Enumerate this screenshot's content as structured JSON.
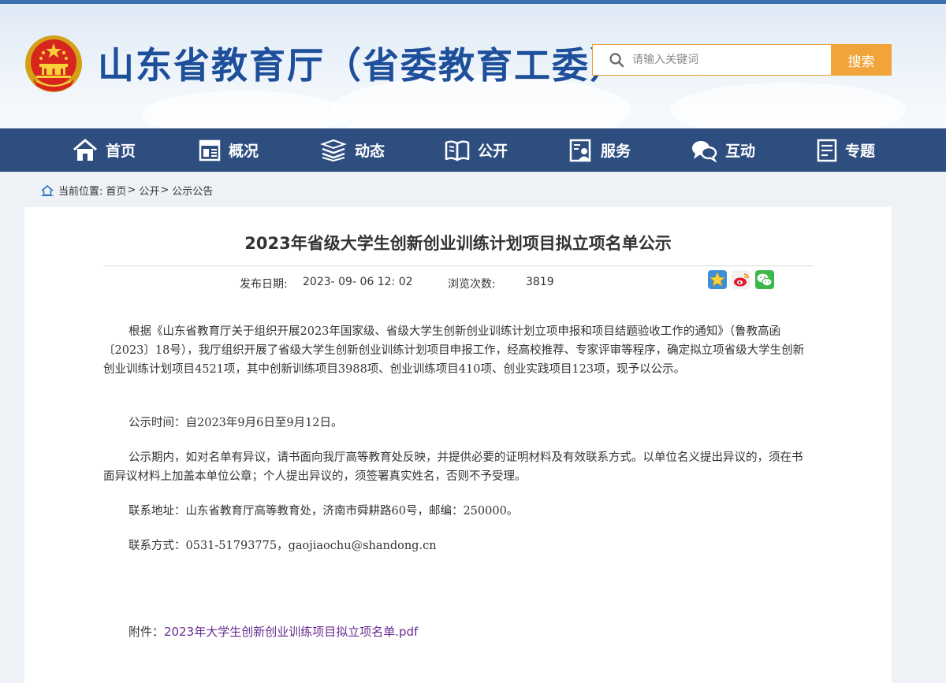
{
  "header": {
    "site_title": "山东省教育厅（省委教育工委）",
    "search_placeholder": "请输入关键词",
    "search_button": "搜索"
  },
  "nav": [
    {
      "label": "首页",
      "icon": "home-icon"
    },
    {
      "label": "概况",
      "icon": "overview-icon"
    },
    {
      "label": "动态",
      "icon": "news-icon"
    },
    {
      "label": "公开",
      "icon": "book-icon"
    },
    {
      "label": "服务",
      "icon": "service-icon"
    },
    {
      "label": "互动",
      "icon": "chat-icon"
    },
    {
      "label": "专题",
      "icon": "topic-icon"
    }
  ],
  "breadcrumb": {
    "prefix": "当前位置:",
    "items": [
      "首页",
      "公开",
      "公示公告"
    ],
    "separator": ">"
  },
  "article": {
    "title": "2023年省级大学生创新创业训练计划项目拟立项名单公示",
    "publish_label": "发布日期:",
    "publish_date": "2023- 09- 06 12: 02",
    "views_label": "浏览次数:",
    "views": "3819",
    "paragraphs": [
      "根据《山东省教育厅关于组织开展2023年国家级、省级大学生创新创业训练计划立项申报和项目结题验收工作的通知》（鲁教高函〔2023〕18号），我厅组织开展了省级大学生创新创业训练计划项目申报工作，经高校推荐、专家评审等程序，确定拟立项省级大学生创新创业训练计划项目4521项，其中创新训练项目3988项、创业训练项目410项、创业实践项目123项，现予以公示。",
      "公示时间：自2023年9月6日至9月12日。",
      "公示期内，如对名单有异议，请书面向我厅高等教育处反映，并提供必要的证明材料及有效联系方式。以单位名义提出异议的，须在书面异议材料上加盖本单位公章；个人提出异议的，须签署真实姓名，否则不予受理。",
      "联系地址：山东省教育厅高等教育处，济南市舜耕路60号，邮编：250000。",
      "联系方式：0531-51793775，gaojiaochu@shandong.cn"
    ],
    "attachment_label": "附件：",
    "attachment_link": "2023年大学生创新创业训练项目拟立项名单.pdf"
  },
  "colors": {
    "nav_bg": "#2e4e80",
    "title_blue": "#1e4f9a",
    "search_orange": "#f0a43a",
    "link_purple": "#6a2c91"
  },
  "share_icons": [
    "qzone-star-icon",
    "weibo-icon",
    "wechat-icon"
  ]
}
